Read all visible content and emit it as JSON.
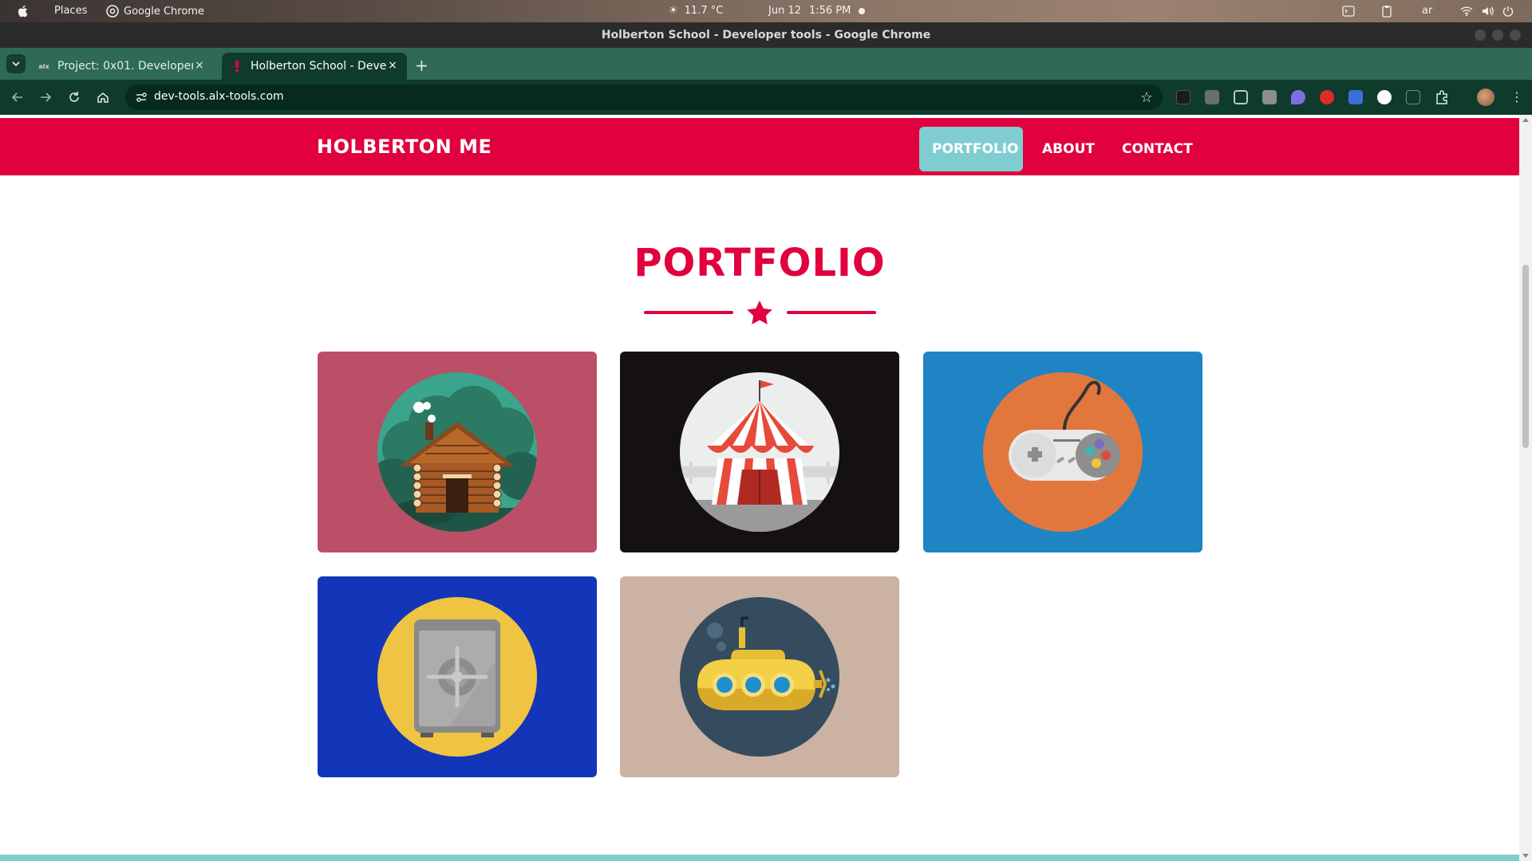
{
  "os_bar": {
    "places_label": "Places",
    "app_label": "Google Chrome",
    "weather": "11.7 °C",
    "date": "Jun 12",
    "time": "1:56 PM",
    "keyboard_layout": "ar"
  },
  "window": {
    "title": "Holberton School - Developer tools - Google Chrome"
  },
  "tabs": [
    {
      "title": "Project: 0x01. Developer",
      "favicon": "alx",
      "active": false
    },
    {
      "title": "Holberton School - Deve",
      "favicon": "holberton",
      "active": true
    }
  ],
  "address_bar": {
    "url": "dev-tools.alx-tools.com"
  },
  "site": {
    "brand": "HOLBERTON ME",
    "nav": [
      {
        "label": "PORTFOLIO",
        "active": true
      },
      {
        "label": "ABOUT",
        "active": false
      },
      {
        "label": "CONTACT",
        "active": false
      }
    ],
    "section_title": "PORTFOLIO",
    "portfolio_items": [
      {
        "icon": "log-cabin-icon",
        "bg": "#bb4f68"
      },
      {
        "icon": "circus-tent-icon",
        "bg": "#151111"
      },
      {
        "icon": "game-controller-icon",
        "bg": "#1e84c3"
      },
      {
        "icon": "safe-icon",
        "bg": "#1335b8"
      },
      {
        "icon": "submarine-icon",
        "bg": "#ccb2a2"
      }
    ]
  },
  "colors": {
    "brand_red": "#e0013e",
    "accent_teal": "#7fcdd0",
    "chrome_green": "#2e6a55"
  }
}
